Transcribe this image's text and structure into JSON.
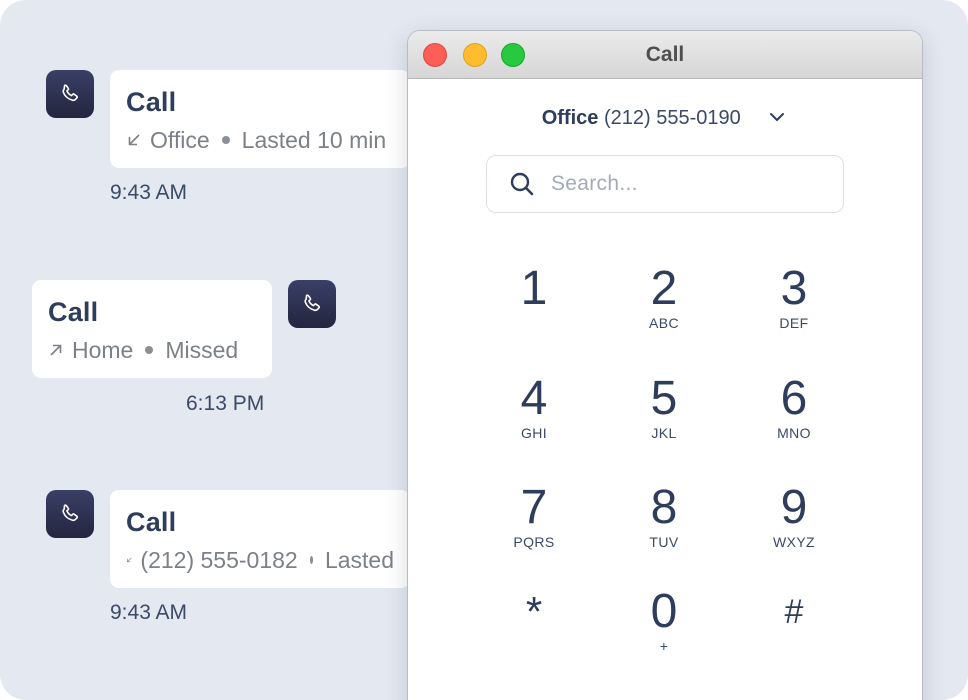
{
  "call_log": [
    {
      "title": "Call",
      "direction": "incoming",
      "detail_1": "Office",
      "detail_2": "Lasted 10 min",
      "time": "9:43 AM"
    },
    {
      "title": "Call",
      "direction": "outgoing",
      "detail_1": "Home",
      "detail_2": "Missed",
      "time": "6:13 PM"
    },
    {
      "title": "Call",
      "direction": "incoming",
      "detail_1": "(212) 555-0182",
      "detail_2": "Lasted",
      "time": "9:43 AM"
    }
  ],
  "window": {
    "title": "Call"
  },
  "line_selector": {
    "name": "Office",
    "number": "(212) 555-0190",
    "icon": "chevron-down-icon"
  },
  "search": {
    "placeholder": "Search...",
    "value": "",
    "icon": "search-icon"
  },
  "keypad": [
    {
      "digit": "1",
      "letters": ""
    },
    {
      "digit": "2",
      "letters": "ABC"
    },
    {
      "digit": "3",
      "letters": "DEF"
    },
    {
      "digit": "4",
      "letters": "GHI"
    },
    {
      "digit": "5",
      "letters": "JKL"
    },
    {
      "digit": "6",
      "letters": "MNO"
    },
    {
      "digit": "7",
      "letters": "PQRS"
    },
    {
      "digit": "8",
      "letters": "TUV"
    },
    {
      "digit": "9",
      "letters": "WXYZ"
    },
    {
      "digit": "*",
      "letters": ""
    },
    {
      "digit": "0",
      "letters": "+"
    },
    {
      "digit": "#",
      "letters": ""
    }
  ],
  "colors": {
    "background": "#e3e8f1",
    "text_primary": "#2f3d5c",
    "avatar": "#2b2f4c",
    "traffic_close": "#fd5f57",
    "traffic_minimize": "#febc2e",
    "traffic_maximize": "#28c840"
  }
}
